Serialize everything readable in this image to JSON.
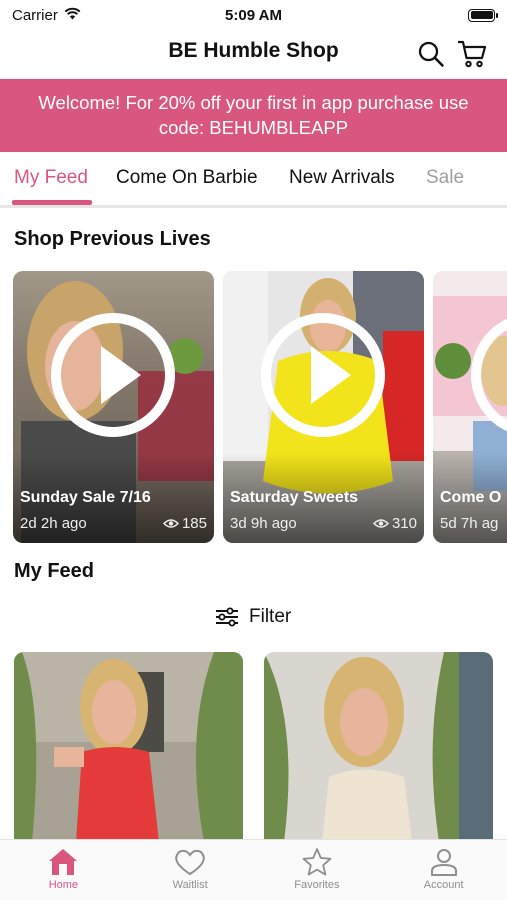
{
  "status_bar": {
    "carrier": "Carrier",
    "time": "5:09 AM"
  },
  "header": {
    "title": "BE Humble Shop"
  },
  "promo": {
    "text": "Welcome! For 20% off your first in app purchase use code: BEHUMBLEAPP"
  },
  "tabs": [
    {
      "label": "My Feed",
      "active": true
    },
    {
      "label": "Come On Barbie"
    },
    {
      "label": "New Arrivals"
    },
    {
      "label": "Sale"
    }
  ],
  "previous_lives": {
    "title": "Shop Previous Lives",
    "items": [
      {
        "title": "Sunday Sale 7/16",
        "ago": "2d 2h ago",
        "views": "185"
      },
      {
        "title": "Saturday Sweets",
        "ago": "3d 9h ago",
        "views": "310"
      },
      {
        "title": "Come O",
        "ago": "5d 7h ag",
        "views": ""
      }
    ]
  },
  "feed": {
    "title": "My Feed",
    "filter_label": "Filter"
  },
  "tabbar": [
    {
      "label": "Home",
      "icon": "home-icon",
      "active": true
    },
    {
      "label": "Waitlist",
      "icon": "heart-icon"
    },
    {
      "label": "Favorites",
      "icon": "star-icon"
    },
    {
      "label": "Account",
      "icon": "person-icon"
    }
  ],
  "colors": {
    "accent": "#d9577f",
    "promo_bg": "#d9577f"
  }
}
